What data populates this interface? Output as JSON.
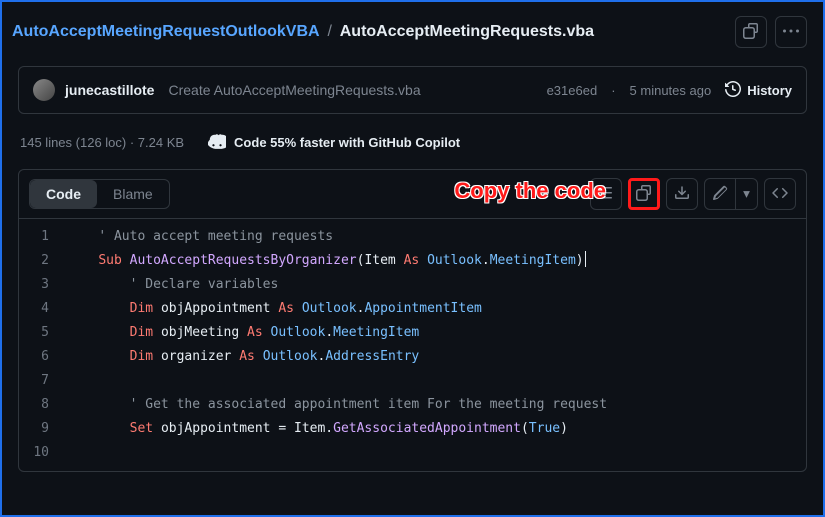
{
  "breadcrumb": {
    "repo": "AutoAcceptMeetingRequestOutlookVBA",
    "sep": "/",
    "file": "AutoAcceptMeetingRequests.vba"
  },
  "commit": {
    "author": "junecastillote",
    "message": "Create AutoAcceptMeetingRequests.vba",
    "sha": "e31e6ed",
    "time": "5 minutes ago",
    "history_label": "History"
  },
  "file_meta": {
    "stats": "145 lines (126 loc) · 7.24 KB",
    "copilot": "Code 55% faster with GitHub Copilot"
  },
  "toolbar": {
    "code_tab": "Code",
    "blame_tab": "Blame",
    "annotation": "Copy the code"
  },
  "code": {
    "lines": [
      {
        "n": "1",
        "tokens": [
          [
            "    ",
            ""
          ],
          [
            "' Auto accept meeting requests",
            "comment"
          ]
        ]
      },
      {
        "n": "2",
        "tokens": [
          [
            "    ",
            ""
          ],
          [
            "Sub ",
            "kw"
          ],
          [
            "AutoAcceptRequestsByOrganizer",
            "fn"
          ],
          [
            "(",
            "punct"
          ],
          [
            "Item ",
            "var"
          ],
          [
            "As ",
            "kw"
          ],
          [
            "Outlook",
            "type"
          ],
          [
            ".",
            "punct"
          ],
          [
            "MeetingItem",
            "type"
          ],
          [
            ")",
            "punct"
          ]
        ],
        "cursor": true
      },
      {
        "n": "3",
        "tokens": [
          [
            "        ",
            ""
          ],
          [
            "' Declare variables",
            "comment"
          ]
        ]
      },
      {
        "n": "4",
        "tokens": [
          [
            "        ",
            ""
          ],
          [
            "Dim ",
            "kw"
          ],
          [
            "objAppointment ",
            "var"
          ],
          [
            "As ",
            "kw"
          ],
          [
            "Outlook",
            "type"
          ],
          [
            ".",
            "punct"
          ],
          [
            "AppointmentItem",
            "type"
          ]
        ]
      },
      {
        "n": "5",
        "tokens": [
          [
            "        ",
            ""
          ],
          [
            "Dim ",
            "kw"
          ],
          [
            "objMeeting ",
            "var"
          ],
          [
            "As ",
            "kw"
          ],
          [
            "Outlook",
            "type"
          ],
          [
            ".",
            "punct"
          ],
          [
            "MeetingItem",
            "type"
          ]
        ]
      },
      {
        "n": "6",
        "tokens": [
          [
            "        ",
            ""
          ],
          [
            "Dim ",
            "kw"
          ],
          [
            "organizer ",
            "var"
          ],
          [
            "As ",
            "kw"
          ],
          [
            "Outlook",
            "type"
          ],
          [
            ".",
            "punct"
          ],
          [
            "AddressEntry",
            "type"
          ]
        ]
      },
      {
        "n": "7",
        "tokens": [
          [
            "",
            ""
          ]
        ]
      },
      {
        "n": "8",
        "tokens": [
          [
            "        ",
            ""
          ],
          [
            "' Get the associated appointment item For the meeting request",
            "comment"
          ]
        ]
      },
      {
        "n": "9",
        "tokens": [
          [
            "        ",
            ""
          ],
          [
            "Set ",
            "kw"
          ],
          [
            "objAppointment = Item.",
            "var"
          ],
          [
            "GetAssociatedAppointment",
            "fn"
          ],
          [
            "(",
            "punct"
          ],
          [
            "True",
            "bool"
          ],
          [
            ")",
            "punct"
          ]
        ]
      },
      {
        "n": "10",
        "tokens": [
          [
            "",
            ""
          ]
        ]
      }
    ]
  }
}
